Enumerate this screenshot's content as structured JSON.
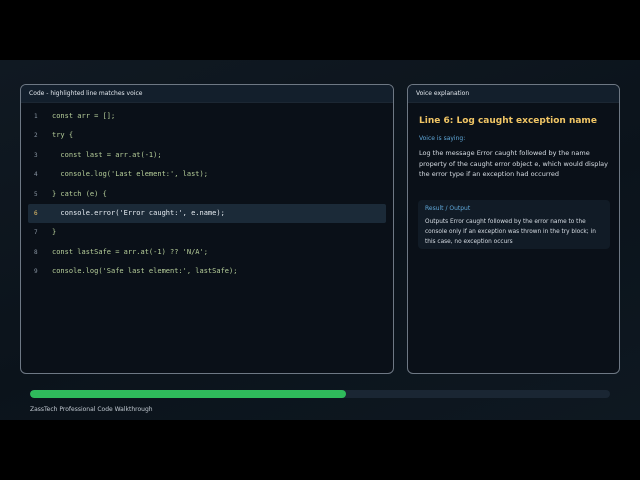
{
  "code_panel": {
    "header": "Code - highlighted line matches voice",
    "highlighted_line": 6,
    "lines": [
      {
        "num": "1",
        "text": "const arr = [];"
      },
      {
        "num": "2",
        "text": "try {"
      },
      {
        "num": "3",
        "text": "  const last = arr.at(-1);"
      },
      {
        "num": "4",
        "text": "  console.log('Last element:', last);"
      },
      {
        "num": "5",
        "text": "} catch (e) {"
      },
      {
        "num": "6",
        "text": "  console.error('Error caught:', e.name);"
      },
      {
        "num": "7",
        "text": "}"
      },
      {
        "num": "8",
        "text": "const lastSafe = arr.at(-1) ?? 'N/A';"
      },
      {
        "num": "9",
        "text": "console.log('Safe last element:', lastSafe);"
      }
    ]
  },
  "voice_panel": {
    "header": "Voice explanation",
    "title": "Line 6: Log caught exception name",
    "subtitle": "Voice is saying:",
    "text": "Log the message Error caught followed by the name property of the caught error object e, which would display the error type if an exception had occurred",
    "result_label": "Result / Output",
    "result_text": "Outputs Error caught followed by the error name to the console only if an exception was thrown in the try block; in this case, no exception occurs"
  },
  "progress": {
    "fraction": 0.545
  },
  "footer": {
    "text": "ZassTech Professional Code Walkthrough"
  },
  "colors": {
    "accent": "#f0c565",
    "progress": "#2fba5b",
    "link": "#5fa7d8",
    "code": "#b7cf9a"
  }
}
